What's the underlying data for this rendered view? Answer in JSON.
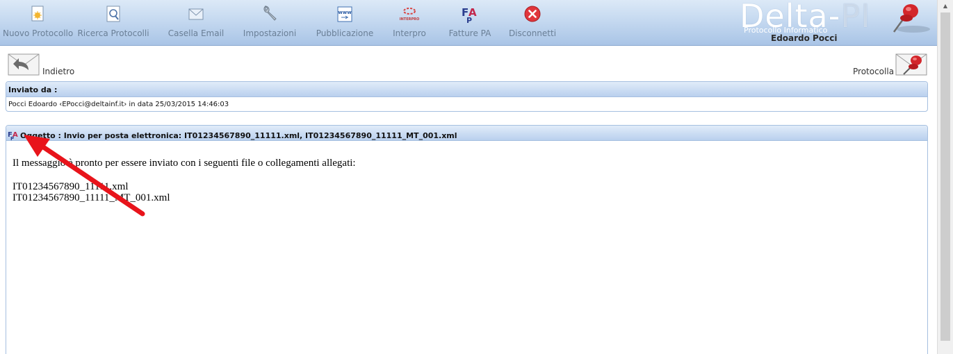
{
  "toolbar": {
    "items": [
      {
        "label": "Nuovo Protocollo",
        "icon": "new-document-icon"
      },
      {
        "label": "Ricerca Protocolli",
        "icon": "search-document-icon"
      },
      {
        "label": "Casella Email",
        "icon": "email-icon"
      },
      {
        "label": "Impostazioni",
        "icon": "wrench-icon"
      },
      {
        "label": "Pubblicazione",
        "icon": "www-icon"
      },
      {
        "label": "Interpro",
        "icon": "interpro-icon"
      },
      {
        "label": "Fatture PA",
        "icon": "fpa-icon"
      },
      {
        "label": "Disconnetti",
        "icon": "close-icon"
      }
    ]
  },
  "brand": {
    "title_part1": "Delta-",
    "title_part2": "PI",
    "subtitle": "Protocollo Informatico",
    "user": "Edoardo Pocci"
  },
  "nav": {
    "back_label": "Indietro",
    "protocol_label": "Protocolla"
  },
  "sender": {
    "header": "Inviato da :",
    "text": "Pocci Edoardo ‹EPocci@deltainf.it› in data 25/03/2015 14:46:03"
  },
  "message": {
    "subject": "Oggetto : Invio per posta elettronica: IT01234567890_11111.xml, IT01234567890_11111_MT_001.xml",
    "intro": "Il messaggio è pronto per essere inviato con i seguenti file o collegamenti allegati:",
    "files": [
      "IT01234567890_11111.xml",
      "IT01234567890_11111_MT_001.xml"
    ]
  },
  "colors": {
    "toolbar_blue": "#a9c4e6",
    "annotation_arrow": "#e8141b",
    "disconnect_red": "#e0363c"
  }
}
